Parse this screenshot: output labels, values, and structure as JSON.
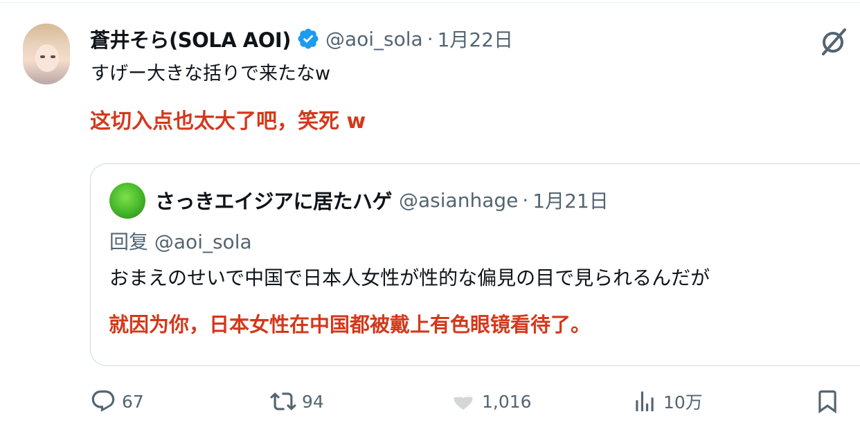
{
  "tweet": {
    "author": {
      "display_name": "蒼井そら(SOLA AOI)",
      "handle": "@aoi_sola",
      "verified": true
    },
    "separator": "·",
    "date": "1月22日",
    "text": "すげー大きな括りで来たなw",
    "translation": "这切入点也太大了吧，笑死 w"
  },
  "quoted_tweet": {
    "author": {
      "display_name": "さっきエイジアに居たハゲ",
      "handle": "@asianhage"
    },
    "separator": "·",
    "date": "1月21日",
    "reply_to_label": "回复 @aoi_sola",
    "text": "おまえのせいで中国で日本人女性が性的な偏見の目で見られるんだが",
    "translation": "就因为你，日本女性在中国都被戴上有色眼镜看待了。"
  },
  "actions": {
    "reply_count": "67",
    "repost_count": "94",
    "like_count": "1,016",
    "views_count": "10万"
  },
  "icons": {
    "verified": "verified-badge-icon",
    "grok": "grok-icon",
    "reply": "reply-icon",
    "repost": "repost-icon",
    "like": "like-icon",
    "views": "views-icon",
    "bookmark": "bookmark-icon"
  },
  "colors": {
    "text_primary": "#0f1419",
    "text_secondary": "#536471",
    "translation": "#d4381b",
    "verified_blue": "#1d9bf0",
    "border": "#cfd9de"
  }
}
